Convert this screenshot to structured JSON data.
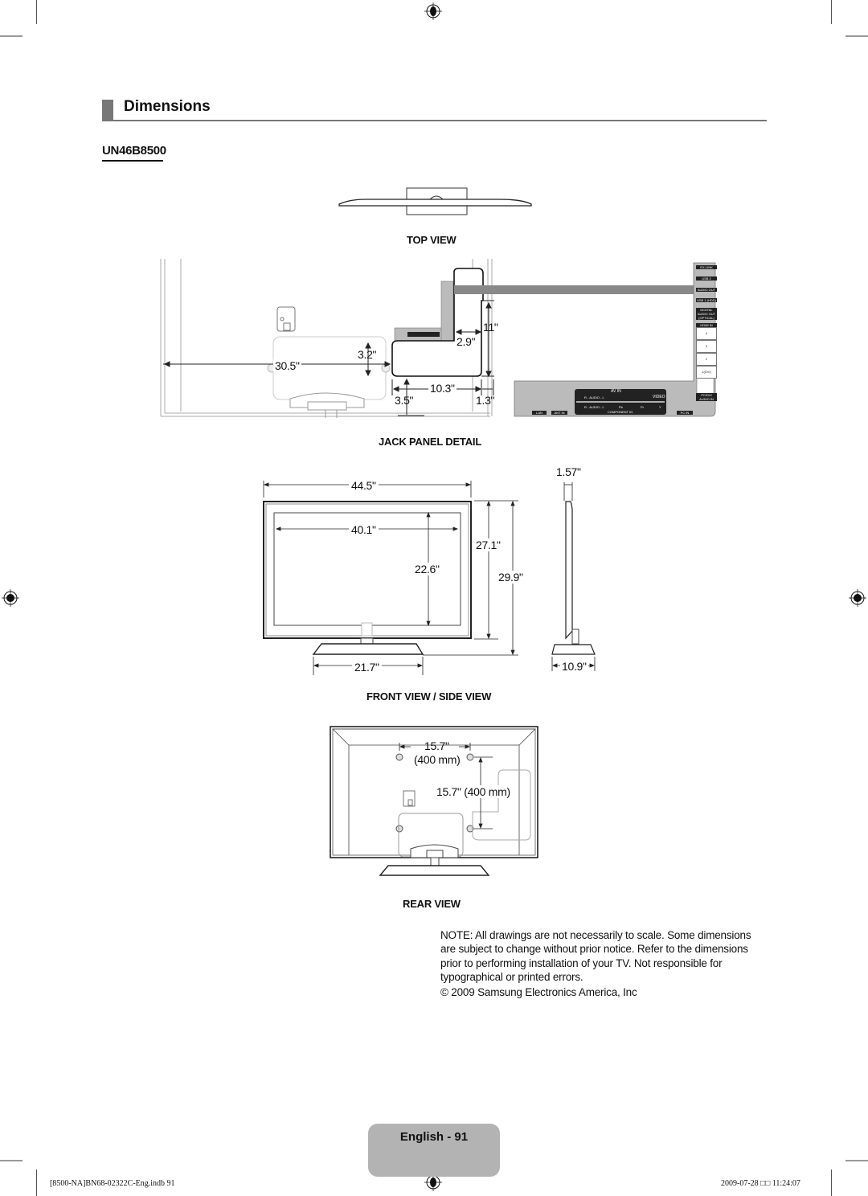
{
  "section": {
    "title": "Dimensions",
    "model": "UN46B8500"
  },
  "top_view": {
    "caption": "TOP VIEW"
  },
  "jack_panel": {
    "caption": "JACK PANEL DETAIL",
    "dimensions": {
      "left_offset": "30.5\"",
      "panel_height_offset": "3.2\"",
      "side_depth": "2.9\"",
      "side_height": "11\"",
      "bottom_width": "10.3\"",
      "bottom_offset": "3.5\"",
      "right_offset": "1.3\""
    },
    "side_ports": [
      "EX-LINK",
      "USB 2",
      "AUDIO OUT",
      "USB 1 (HDD)",
      "DIGITAL AUDIO OUT (OPTICAL)",
      "HDMI IN",
      "4",
      "3",
      "2",
      "1(DVI)"
    ],
    "bottom_ports": {
      "av_in": "AV IN",
      "audio_top": "R - AUDIO - L",
      "video": "VIDEO",
      "audio_bottom": "R - AUDIO - L",
      "pb": "Pb",
      "pr": "Pr",
      "y": "Y",
      "component_in": "COMPONENT IN",
      "lan": "LAN",
      "ant_in": "ANT IN",
      "pc_in": "PC IN",
      "pc_dvi_audio": "PC/DVI AUDIO IN"
    }
  },
  "front_side_view": {
    "caption": "FRONT VIEW / SIDE VIEW",
    "dimensions": {
      "overall_width": "44.5\"",
      "screen_width": "40.1\"",
      "screen_height": "22.6\"",
      "height_without_stand": "27.1\"",
      "height_with_stand": "29.9\"",
      "stand_width": "21.7\"",
      "depth": "1.57\"",
      "stand_depth": "10.9\""
    }
  },
  "rear_view": {
    "caption": "REAR VIEW",
    "dimensions": {
      "vesa_horizontal": "15.7\"",
      "vesa_horizontal_mm": "(400 mm)",
      "vesa_vertical": "15.7\" (400 mm)"
    }
  },
  "note": {
    "text": "NOTE: All drawings are not necessarily to scale. Some dimensions are subject to change without prior notice. Refer to the dimensions prior to performing installation of your TV. Not responsible for typographical or printed errors.",
    "copyright": "© 2009 Samsung Electronics America, Inc"
  },
  "footer": {
    "page_label": "English - 91",
    "file_info": "[8500-NA]BN68-02322C-Eng.indb   91",
    "timestamp": "2009-07-28   □□ 11:24:07"
  }
}
